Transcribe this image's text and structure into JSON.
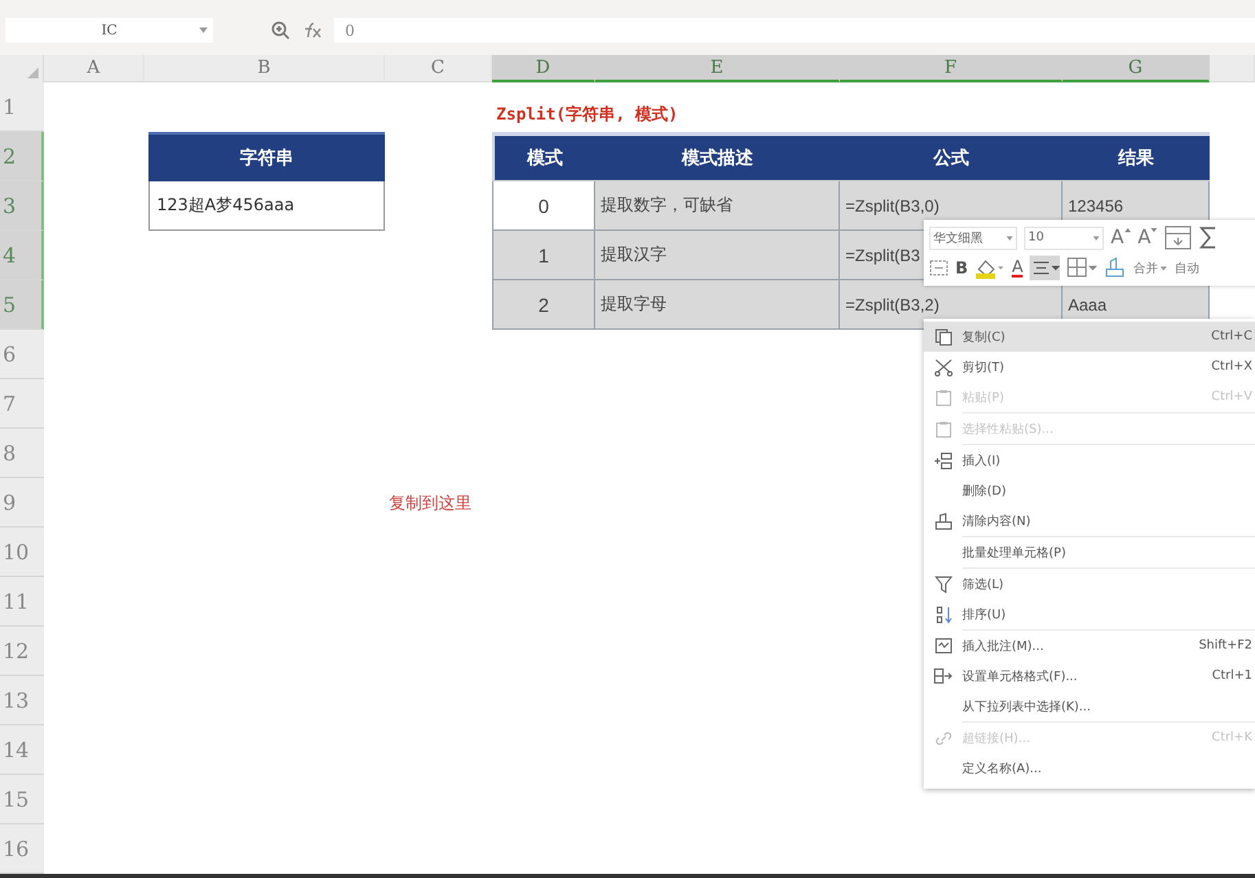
{
  "formula_bar": {
    "name_box": "IC",
    "formula": "0"
  },
  "column_headers": [
    {
      "label": "A",
      "selected": false
    },
    {
      "label": "B",
      "selected": false
    },
    {
      "label": "C",
      "selected": false
    },
    {
      "label": "D",
      "selected": true
    },
    {
      "label": "E",
      "selected": true
    },
    {
      "label": "F",
      "selected": true
    },
    {
      "label": "G",
      "selected": true
    }
  ],
  "row_headers": [
    {
      "label": "1",
      "selected": false
    },
    {
      "label": "2",
      "selected": true
    },
    {
      "label": "3",
      "selected": true
    },
    {
      "label": "4",
      "selected": true
    },
    {
      "label": "5",
      "selected": true
    },
    {
      "label": "6",
      "selected": false
    },
    {
      "label": "7",
      "selected": false
    },
    {
      "label": "8",
      "selected": false
    },
    {
      "label": "9",
      "selected": false
    },
    {
      "label": "10",
      "selected": false
    },
    {
      "label": "11",
      "selected": false
    },
    {
      "label": "12",
      "selected": false
    },
    {
      "label": "13",
      "selected": false
    },
    {
      "label": "14",
      "selected": false
    },
    {
      "label": "15",
      "selected": false
    },
    {
      "label": "16",
      "selected": false
    }
  ],
  "syntax_title": "Zsplit(字符串, 模式)",
  "source_table": {
    "header": "字符串",
    "value": "123超A梦456aaa"
  },
  "mode_table": {
    "columns": [
      "模式",
      "模式描述",
      "公式",
      "结果"
    ],
    "rows": [
      {
        "mode": "0",
        "description": "提取数字，可缺省",
        "formula": "=Zsplit(B3,0)",
        "result": "123456",
        "active": true
      },
      {
        "mode": "1",
        "description": "提取汉字",
        "formula": "=Zsplit(B3",
        "active": false
      },
      {
        "mode": "2",
        "description": "提取字母",
        "formula": "=Zsplit(B3,2)",
        "result": "Aaaa",
        "active": false
      }
    ]
  },
  "note": "复制到这里",
  "mini_toolbar": {
    "font": "华文细黑",
    "size": "10",
    "grow_label": "A",
    "shrink_label": "A",
    "bold_label": "B",
    "font_color_label": "A",
    "merge_label": "合并",
    "wrap_label": "自动"
  },
  "context_menu": [
    {
      "label": "复制(C)",
      "shortcut": "Ctrl+C",
      "selected": true,
      "disabled": false,
      "divider_after": false
    },
    {
      "label": "剪切(T)",
      "shortcut": "Ctrl+X",
      "selected": false,
      "disabled": false,
      "divider_after": false
    },
    {
      "label": "粘贴(P)",
      "shortcut": "Ctrl+V",
      "selected": false,
      "disabled": true,
      "divider_after": true
    },
    {
      "label": "选择性粘贴(S)...",
      "selected": false,
      "disabled": true,
      "divider_after": true
    },
    {
      "label": "插入(I)",
      "selected": false,
      "disabled": false,
      "divider_after": false
    },
    {
      "label": "删除(D)",
      "selected": false,
      "disabled": false,
      "divider_after": false
    },
    {
      "label": "清除内容(N)",
      "selected": false,
      "disabled": false,
      "divider_after": true
    },
    {
      "label": "批量处理单元格(P)",
      "selected": false,
      "disabled": false,
      "divider_after": true
    },
    {
      "label": "筛选(L)",
      "selected": false,
      "disabled": false,
      "divider_after": false
    },
    {
      "label": "排序(U)",
      "selected": false,
      "disabled": false,
      "divider_after": true
    },
    {
      "label": "插入批注(M)...",
      "shortcut": "Shift+F2",
      "selected": false,
      "disabled": false,
      "divider_after": false
    },
    {
      "label": "设置单元格格式(F)...",
      "shortcut": "Ctrl+1",
      "selected": false,
      "disabled": false,
      "divider_after": false
    },
    {
      "label": "从下拉列表中选择(K)...",
      "selected": false,
      "disabled": false,
      "divider_after": true
    },
    {
      "label": "超链接(H)...",
      "shortcut": "Ctrl+K",
      "selected": false,
      "disabled": true,
      "divider_after": false
    },
    {
      "label": "定义名称(A)...",
      "selected": false,
      "disabled": false,
      "divider_after": false
    }
  ]
}
